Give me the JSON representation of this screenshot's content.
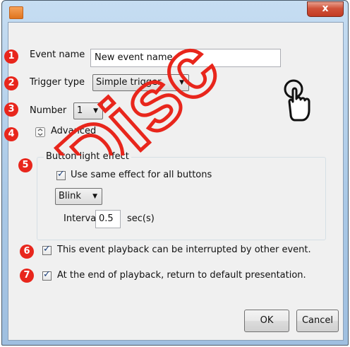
{
  "window": {
    "close_glyph": "x"
  },
  "watermark": {
    "text": "Disc"
  },
  "form": {
    "event_name_label": "Event name",
    "event_name_value": "New event name",
    "trigger_type_label": "Trigger type",
    "trigger_type_value": "Simple trigger",
    "number_label": "Number",
    "number_value": "1",
    "advanced_label": "Advanced"
  },
  "button_light_effect": {
    "title": "Button light effect",
    "same_effect_label": "Use same effect for all buttons",
    "same_effect_checked": true,
    "effect_value": "Blink",
    "interval_label": "Interval",
    "interval_value": "0.5",
    "interval_unit": "sec(s)"
  },
  "options": {
    "interruptible_label": "This event playback can be interrupted by other event.",
    "interruptible_checked": true,
    "return_default_label": "At the end of playback, return to default presentation.",
    "return_default_checked": true
  },
  "buttons": {
    "ok": "OK",
    "cancel": "Cancel"
  },
  "badges": [
    "1",
    "2",
    "3",
    "4",
    "5",
    "6",
    "7"
  ],
  "colors": {
    "badge": "#e8261c",
    "watermark": "#e8261c",
    "title_bar": "#b4d1ee"
  },
  "icons": {
    "app": "app-icon",
    "close": "close-icon",
    "advanced": "expand-icon",
    "hand": "hand-pointer-icon",
    "dropdown": "chevron-down-icon"
  }
}
